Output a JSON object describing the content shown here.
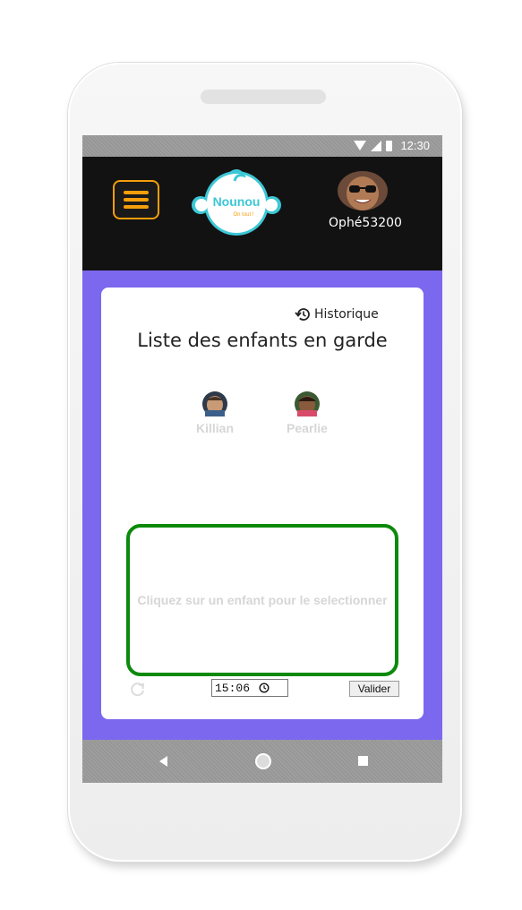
{
  "status_bar": {
    "time": "12:30"
  },
  "header": {
    "logo_text": "Nounou",
    "logo_subtext": "On tout !",
    "user_name": "Ophé53200"
  },
  "card": {
    "history_label": "Historique",
    "title": "Liste des enfants en garde",
    "children": [
      {
        "name": "Killian"
      },
      {
        "name": "Pearlie"
      }
    ],
    "select_hint": "Cliquez sur un enfant pour le selectionner",
    "time_value": "15:06",
    "validate_label": "Valider"
  },
  "colors": {
    "header_bg": "#121212",
    "accent_orange": "#f59e0b",
    "content_bg": "#7b68ee",
    "select_border": "#0b8a0b",
    "logo_teal": "#3cc7d6"
  }
}
